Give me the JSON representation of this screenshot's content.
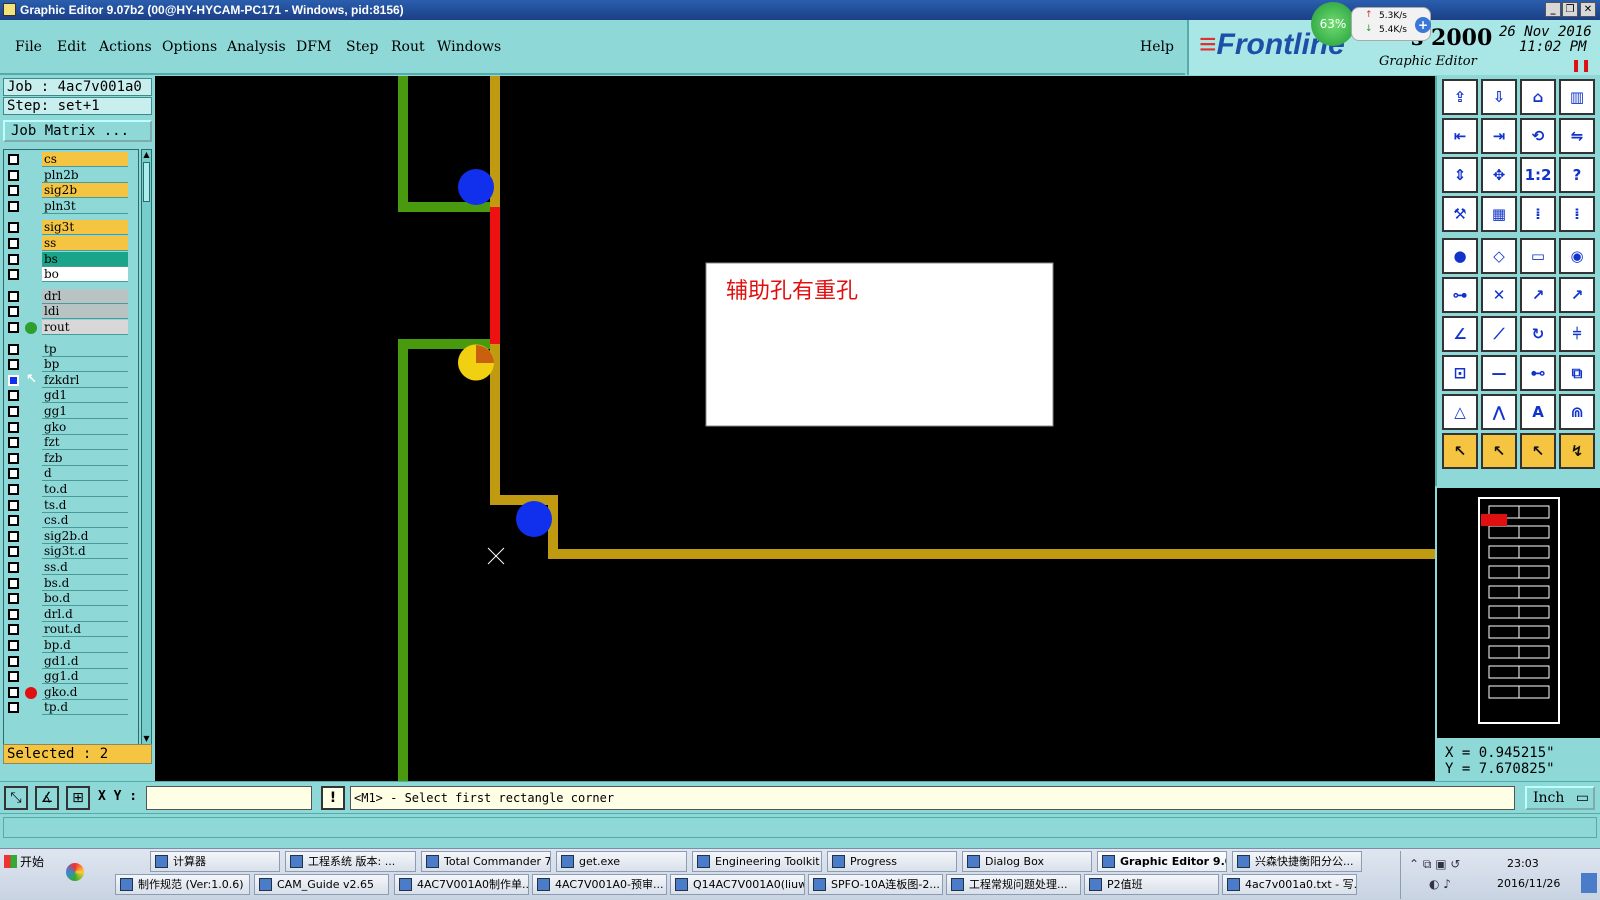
{
  "window": {
    "title": "Graphic Editor 9.07b2 (00@HY-HYCAM-PC171 - Windows, pid:8156)"
  },
  "menu": {
    "items": [
      "File",
      "Edit",
      "Actions",
      "Options",
      "Analysis",
      "DFM",
      "Step",
      "Rout",
      "Windows"
    ],
    "help": "Help"
  },
  "brand": {
    "logo": "Frontline",
    "product_suffix": "s 2000",
    "date": "26 Nov 2016",
    "time": "11:02 PM",
    "subtitle": "Graphic Editor",
    "net_percent": "63%",
    "net_up": "5.3K/s",
    "net_down": "5.4K/s"
  },
  "job": {
    "job_label": "Job  : 4ac7v001a0",
    "step_label": "Step:  set+1",
    "matrix_button": "Job Matrix ...",
    "selected": "Selected : 2"
  },
  "layers": [
    {
      "name": "cs",
      "color": "#f5c542"
    },
    {
      "name": "pln2b",
      "color": "#8fd8d8"
    },
    {
      "name": "sig2b",
      "color": "#f5c542"
    },
    {
      "name": "pln3t",
      "color": "#8fd8d8"
    },
    {
      "name": "sig3t",
      "color": "#f5c542"
    },
    {
      "name": "ss",
      "color": "#f5c542"
    },
    {
      "name": "bs",
      "color": "#1aa48a"
    },
    {
      "name": "bo",
      "color": "#ffffff"
    },
    {
      "name": "drl",
      "color": "#b8c4c4"
    },
    {
      "name": "ldi",
      "color": "#b8c4c4"
    },
    {
      "name": "rout",
      "color": "#d8d8d8",
      "dot": "#2e9e2e"
    },
    {
      "name": "tp",
      "color": "#8fd8d8"
    },
    {
      "name": "bp",
      "color": "#8fd8d8"
    },
    {
      "name": "fzkdrl",
      "color": "#8fd8d8",
      "active": true
    },
    {
      "name": "gd1",
      "color": "#8fd8d8"
    },
    {
      "name": "gg1",
      "color": "#8fd8d8"
    },
    {
      "name": "gko",
      "color": "#8fd8d8"
    },
    {
      "name": "fzt",
      "color": "#8fd8d8"
    },
    {
      "name": "fzb",
      "color": "#8fd8d8"
    },
    {
      "name": "d",
      "color": "#8fd8d8"
    },
    {
      "name": "to.d",
      "color": "#8fd8d8"
    },
    {
      "name": "ts.d",
      "color": "#8fd8d8"
    },
    {
      "name": "cs.d",
      "color": "#8fd8d8"
    },
    {
      "name": "sig2b.d",
      "color": "#8fd8d8"
    },
    {
      "name": "sig3t.d",
      "color": "#8fd8d8"
    },
    {
      "name": "ss.d",
      "color": "#8fd8d8"
    },
    {
      "name": "bs.d",
      "color": "#8fd8d8"
    },
    {
      "name": "bo.d",
      "color": "#8fd8d8"
    },
    {
      "name": "drl.d",
      "color": "#8fd8d8"
    },
    {
      "name": "rout.d",
      "color": "#8fd8d8"
    },
    {
      "name": "bp.d",
      "color": "#8fd8d8"
    },
    {
      "name": "gd1.d",
      "color": "#8fd8d8"
    },
    {
      "name": "gg1.d",
      "color": "#8fd8d8"
    },
    {
      "name": "gko.d",
      "color": "#8fd8d8",
      "dot": "#e01010"
    },
    {
      "name": "tp.d",
      "color": "#8fd8d8"
    }
  ],
  "canvas": {
    "annotation": "辅助孔有重孔",
    "colors": {
      "green": "#4a9a10",
      "gold": "#c09a10",
      "red": "#ee1111",
      "blue": "#1030ee",
      "yellow": "#f0d010"
    }
  },
  "coords": {
    "x": "X = 0.945215\"",
    "y": "Y = 7.670825\""
  },
  "command": {
    "xy_label": "X Y :",
    "xy_value": "",
    "prompt": "<M1> - Select first rectangle corner",
    "units": "Inch"
  },
  "taskbar": {
    "start": "开始",
    "row1": [
      "计算器",
      "工程系统  版本: ...",
      "Total Commander 7...",
      "get.exe",
      "Engineering Toolkit ...",
      "Progress",
      "Dialog Box",
      "Graphic Editor 9.0...",
      "兴森快捷衡阳分公..."
    ],
    "row2": [
      "制作规范 (Ver:1.0.6)",
      "CAM_Guide v2.65",
      "4AC7V001A0制作单...",
      "4AC7V001A0-预审...",
      "Q14AC7V001A0(liuw...",
      "SPFO-10A连板图-2...",
      "工程常规问题处理...",
      "P2值班",
      "4ac7v001a0.txt - 写..."
    ],
    "clock_time": "23:03",
    "clock_date": "2016/11/26"
  }
}
